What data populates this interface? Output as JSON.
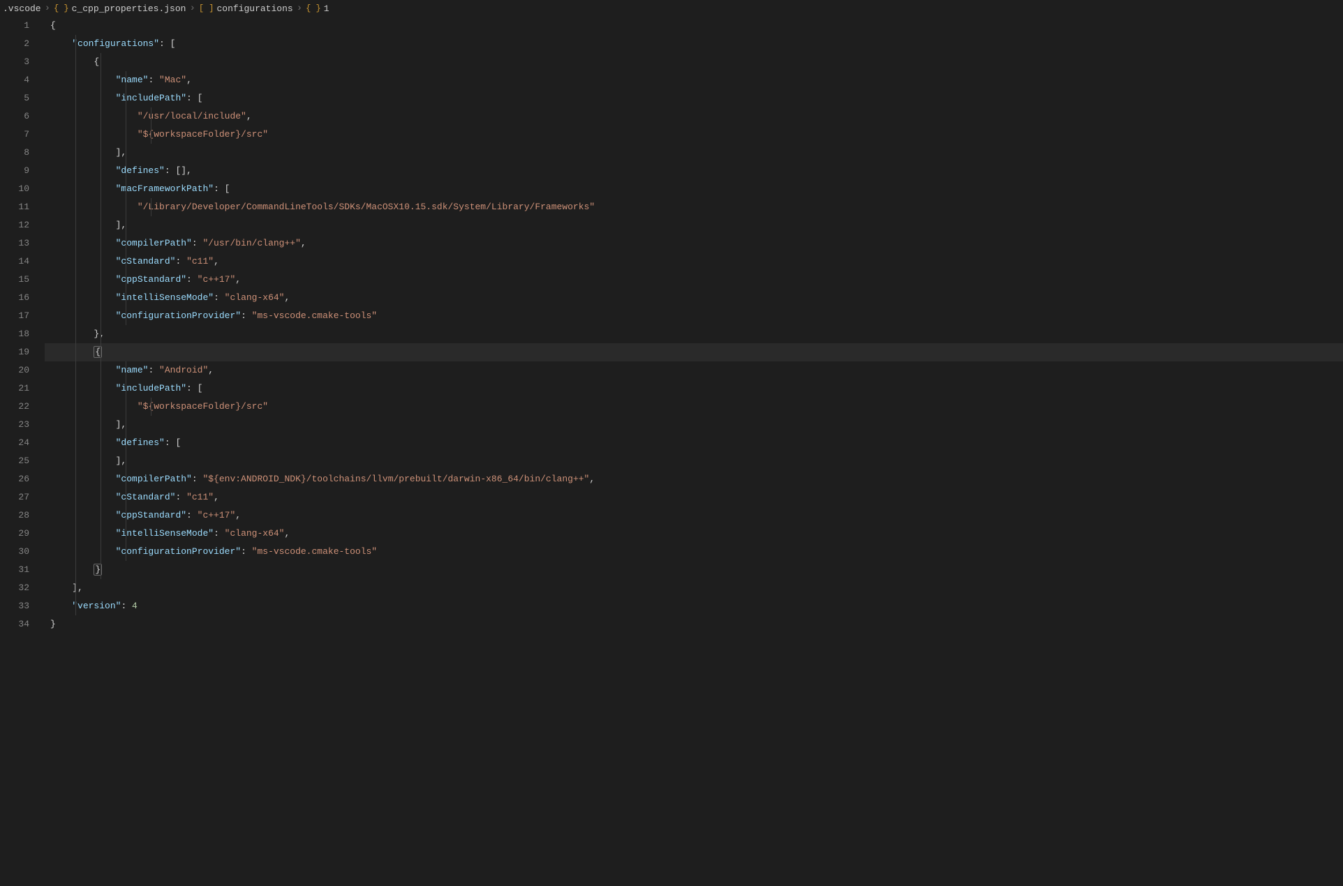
{
  "breadcrumb": {
    "items": [
      {
        "icon": "",
        "label": ".vscode"
      },
      {
        "icon": "{ }",
        "label": "c_cpp_properties.json"
      },
      {
        "icon": "[ ]",
        "label": "configurations"
      },
      {
        "icon": "{ }",
        "label": "1"
      }
    ]
  },
  "editor": {
    "activeLine": 19,
    "lines": [
      {
        "num": 1,
        "indent": 0,
        "tokens": [
          [
            "p",
            "{"
          ]
        ]
      },
      {
        "num": 2,
        "indent": 1,
        "tokens": [
          [
            "k",
            "\"configurations\""
          ],
          [
            "p",
            ": ["
          ]
        ]
      },
      {
        "num": 3,
        "indent": 2,
        "tokens": [
          [
            "p",
            "{"
          ]
        ]
      },
      {
        "num": 4,
        "indent": 3,
        "tokens": [
          [
            "k",
            "\"name\""
          ],
          [
            "p",
            ": "
          ],
          [
            "s",
            "\"Mac\""
          ],
          [
            "p",
            ","
          ]
        ]
      },
      {
        "num": 5,
        "indent": 3,
        "tokens": [
          [
            "k",
            "\"includePath\""
          ],
          [
            "p",
            ": ["
          ]
        ]
      },
      {
        "num": 6,
        "indent": 4,
        "tokens": [
          [
            "s",
            "\"/usr/local/include\""
          ],
          [
            "p",
            ","
          ]
        ]
      },
      {
        "num": 7,
        "indent": 4,
        "tokens": [
          [
            "s",
            "\"${workspaceFolder}/src\""
          ]
        ]
      },
      {
        "num": 8,
        "indent": 3,
        "tokens": [
          [
            "p",
            "],"
          ]
        ]
      },
      {
        "num": 9,
        "indent": 3,
        "tokens": [
          [
            "k",
            "\"defines\""
          ],
          [
            "p",
            ": [],"
          ]
        ]
      },
      {
        "num": 10,
        "indent": 3,
        "tokens": [
          [
            "k",
            "\"macFrameworkPath\""
          ],
          [
            "p",
            ": ["
          ]
        ]
      },
      {
        "num": 11,
        "indent": 4,
        "tokens": [
          [
            "s",
            "\"/Library/Developer/CommandLineTools/SDKs/MacOSX10.15.sdk/System/Library/Frameworks\""
          ]
        ]
      },
      {
        "num": 12,
        "indent": 3,
        "tokens": [
          [
            "p",
            "],"
          ]
        ]
      },
      {
        "num": 13,
        "indent": 3,
        "tokens": [
          [
            "k",
            "\"compilerPath\""
          ],
          [
            "p",
            ": "
          ],
          [
            "s",
            "\"/usr/bin/clang++\""
          ],
          [
            "p",
            ","
          ]
        ]
      },
      {
        "num": 14,
        "indent": 3,
        "tokens": [
          [
            "k",
            "\"cStandard\""
          ],
          [
            "p",
            ": "
          ],
          [
            "s",
            "\"c11\""
          ],
          [
            "p",
            ","
          ]
        ]
      },
      {
        "num": 15,
        "indent": 3,
        "tokens": [
          [
            "k",
            "\"cppStandard\""
          ],
          [
            "p",
            ": "
          ],
          [
            "s",
            "\"c++17\""
          ],
          [
            "p",
            ","
          ]
        ]
      },
      {
        "num": 16,
        "indent": 3,
        "tokens": [
          [
            "k",
            "\"intelliSenseMode\""
          ],
          [
            "p",
            ": "
          ],
          [
            "s",
            "\"clang-x64\""
          ],
          [
            "p",
            ","
          ]
        ]
      },
      {
        "num": 17,
        "indent": 3,
        "tokens": [
          [
            "k",
            "\"configurationProvider\""
          ],
          [
            "p",
            ": "
          ],
          [
            "s",
            "\"ms-vscode.cmake-tools\""
          ]
        ]
      },
      {
        "num": 18,
        "indent": 2,
        "tokens": [
          [
            "p",
            "},"
          ]
        ]
      },
      {
        "num": 19,
        "indent": 2,
        "tokens": [
          [
            "p-hl",
            "{"
          ]
        ]
      },
      {
        "num": 20,
        "indent": 3,
        "tokens": [
          [
            "k",
            "\"name\""
          ],
          [
            "p",
            ": "
          ],
          [
            "s",
            "\"Android\""
          ],
          [
            "p",
            ","
          ]
        ]
      },
      {
        "num": 21,
        "indent": 3,
        "tokens": [
          [
            "k",
            "\"includePath\""
          ],
          [
            "p",
            ": ["
          ]
        ]
      },
      {
        "num": 22,
        "indent": 4,
        "tokens": [
          [
            "s",
            "\"${workspaceFolder}/src\""
          ]
        ]
      },
      {
        "num": 23,
        "indent": 3,
        "tokens": [
          [
            "p",
            "],"
          ]
        ]
      },
      {
        "num": 24,
        "indent": 3,
        "tokens": [
          [
            "k",
            "\"defines\""
          ],
          [
            "p",
            ": ["
          ]
        ]
      },
      {
        "num": 25,
        "indent": 3,
        "tokens": [
          [
            "p",
            "],"
          ]
        ]
      },
      {
        "num": 26,
        "indent": 3,
        "tokens": [
          [
            "k",
            "\"compilerPath\""
          ],
          [
            "p",
            ": "
          ],
          [
            "s",
            "\"${env:ANDROID_NDK}/toolchains/llvm/prebuilt/darwin-x86_64/bin/clang++\""
          ],
          [
            "p",
            ","
          ]
        ]
      },
      {
        "num": 27,
        "indent": 3,
        "tokens": [
          [
            "k",
            "\"cStandard\""
          ],
          [
            "p",
            ": "
          ],
          [
            "s",
            "\"c11\""
          ],
          [
            "p",
            ","
          ]
        ]
      },
      {
        "num": 28,
        "indent": 3,
        "tokens": [
          [
            "k",
            "\"cppStandard\""
          ],
          [
            "p",
            ": "
          ],
          [
            "s",
            "\"c++17\""
          ],
          [
            "p",
            ","
          ]
        ]
      },
      {
        "num": 29,
        "indent": 3,
        "tokens": [
          [
            "k",
            "\"intelliSenseMode\""
          ],
          [
            "p",
            ": "
          ],
          [
            "s",
            "\"clang-x64\""
          ],
          [
            "p",
            ","
          ]
        ]
      },
      {
        "num": 30,
        "indent": 3,
        "tokens": [
          [
            "k",
            "\"configurationProvider\""
          ],
          [
            "p",
            ": "
          ],
          [
            "s",
            "\"ms-vscode.cmake-tools\""
          ]
        ]
      },
      {
        "num": 31,
        "indent": 2,
        "tokens": [
          [
            "p-hl",
            "}"
          ]
        ]
      },
      {
        "num": 32,
        "indent": 1,
        "tokens": [
          [
            "p",
            "],"
          ]
        ]
      },
      {
        "num": 33,
        "indent": 1,
        "tokens": [
          [
            "k",
            "\"version\""
          ],
          [
            "p",
            ": "
          ],
          [
            "n",
            "4"
          ]
        ]
      },
      {
        "num": 34,
        "indent": 0,
        "tokens": [
          [
            "p",
            "}"
          ]
        ]
      }
    ],
    "indentSize": 4,
    "indentPx": 36
  }
}
